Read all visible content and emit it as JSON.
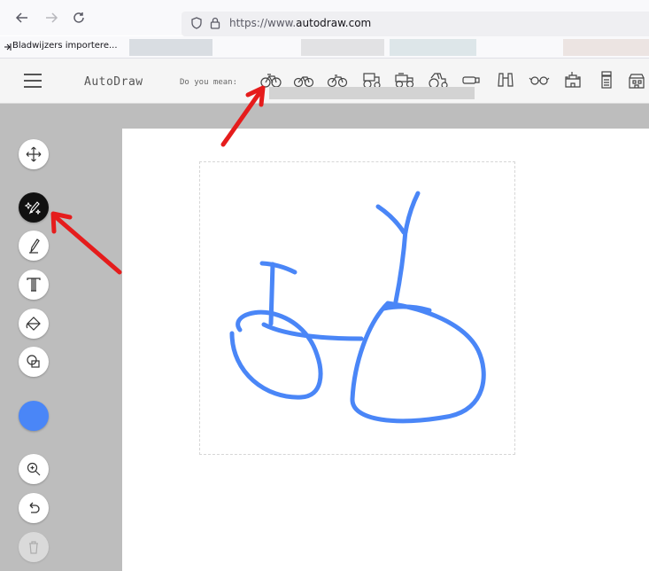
{
  "browser": {
    "url_prefix": "https://www.",
    "url_domain": "autodraw.com",
    "bookmark_import_label": "Bladwijzers importere..."
  },
  "app": {
    "title": "AutoDraw",
    "suggestions_label": "Do you mean:",
    "suggestion_icons": [
      "bicycle-icon",
      "bicycle-icon",
      "bicycle-icon",
      "tractor-icon",
      "tractor-icon",
      "tractor-icon",
      "canister-icon",
      "binoculars-icon",
      "glasses-icon",
      "castle-icon",
      "trash-can-icon",
      "building-icon"
    ]
  },
  "toolbar": {
    "tools": [
      "move",
      "autodraw",
      "draw",
      "type",
      "fill",
      "shape"
    ],
    "current_color": "#4a86f7",
    "bottom_tools": [
      "zoom",
      "undo",
      "delete"
    ]
  },
  "drawing": {
    "stroke_color": "#4a86f7"
  },
  "annotations": {
    "arrow_color": "#e51c1c"
  }
}
